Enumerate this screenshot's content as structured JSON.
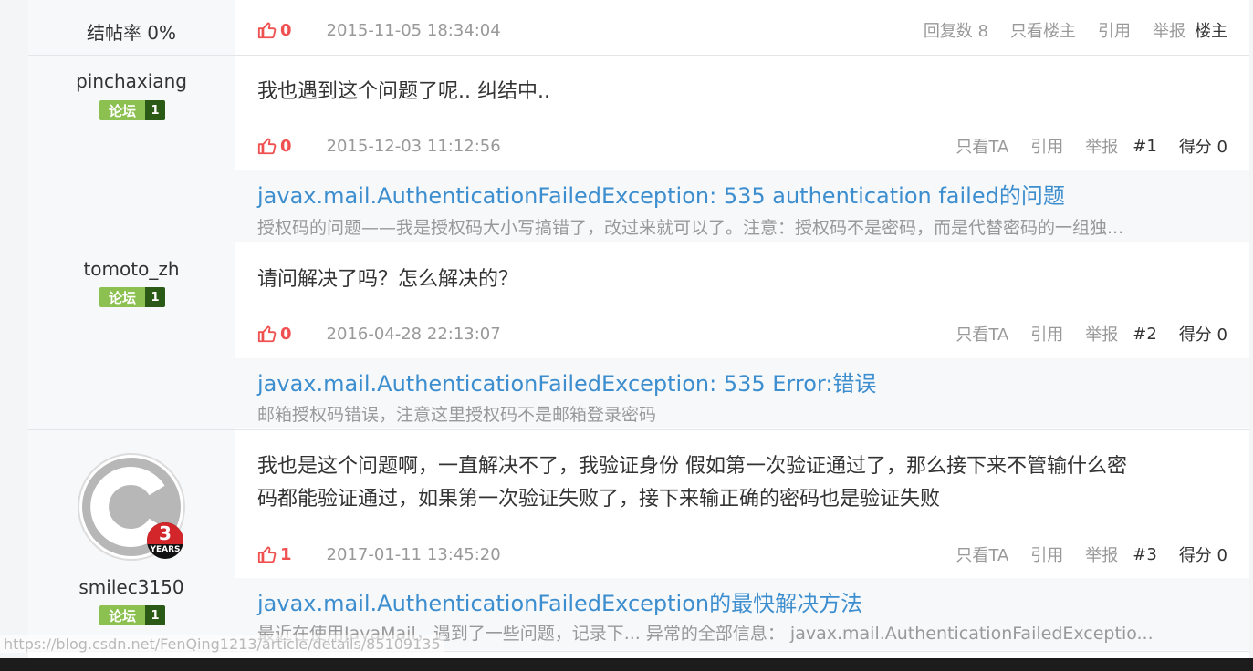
{
  "thread_header": {
    "finish_rate": "结帖率 0%",
    "likes": "0",
    "timestamp": "2015-11-05 18:34:04",
    "reply_count": "回复数 8",
    "only_op": "只看楼主",
    "quote": "引用",
    "report": "举报",
    "floor": "楼主"
  },
  "replies": [
    {
      "username": "pinchaxiang",
      "badge_label": "论坛",
      "badge_level": "1",
      "content_lines": [
        "我也遇到这个问题了呢.. 纠结中.."
      ],
      "likes": "0",
      "timestamp": "2015-12-03 11:12:56",
      "only_ta": "只看TA",
      "quote": "引用",
      "report": "举报",
      "floor": "#1",
      "score": "得分 0",
      "related_title": "javax.mail.AuthenticationFailedException: 535 authentication failed的问题",
      "related_desc": "授权码的问题——我是授权码大小写搞错了，改过来就可以了。注意：授权码不是密码，而是代替密码的一组独..."
    },
    {
      "username": "tomoto_zh",
      "badge_label": "论坛",
      "badge_level": "1",
      "content_lines": [
        "请问解决了吗？怎么解决的？"
      ],
      "likes": "0",
      "timestamp": "2016-04-28 22:13:07",
      "only_ta": "只看TA",
      "quote": "引用",
      "report": "举报",
      "floor": "#2",
      "score": "得分 0",
      "related_title": "javax.mail.AuthenticationFailedException: 535 Error:错误",
      "related_desc": "邮箱授权码错误，注意这里授权码不是邮箱登录密码"
    },
    {
      "username": "smilec3150",
      "badge_label": "论坛",
      "badge_level": "1",
      "avatar_letter": "C",
      "years_number": "3",
      "years_label": "YEARS",
      "content_lines": [
        "我也是这个问题啊，一直解决不了，我验证身份  假如第一次验证通过了，那么接下来不管输什么密",
        "码都能验证通过，如果第一次验证失败了，接下来输正确的密码也是验证失败"
      ],
      "likes": "1",
      "timestamp": "2017-01-11 13:45:20",
      "only_ta": "只看TA",
      "quote": "引用",
      "report": "举报",
      "floor": "#3",
      "score": "得分 0",
      "related_title": "javax.mail.AuthenticationFailedException的最快解决方法",
      "related_desc": "最近在使用JavaMail，遇到了一些问题，记录下... 异常的全部信息： javax.mail.AuthenticationFailedExceptio..."
    }
  ],
  "status_url": "https://blog.csdn.net/FenQing1213/article/details/85109135",
  "colors": {
    "accent": "#f0504f",
    "link": "#3d8ecf",
    "badge_green": "#8cc152",
    "badge_dark": "#2b5a17"
  },
  "icons": [
    "thumbs-up-icon",
    "avatar-icon",
    "years-badge-icon"
  ]
}
